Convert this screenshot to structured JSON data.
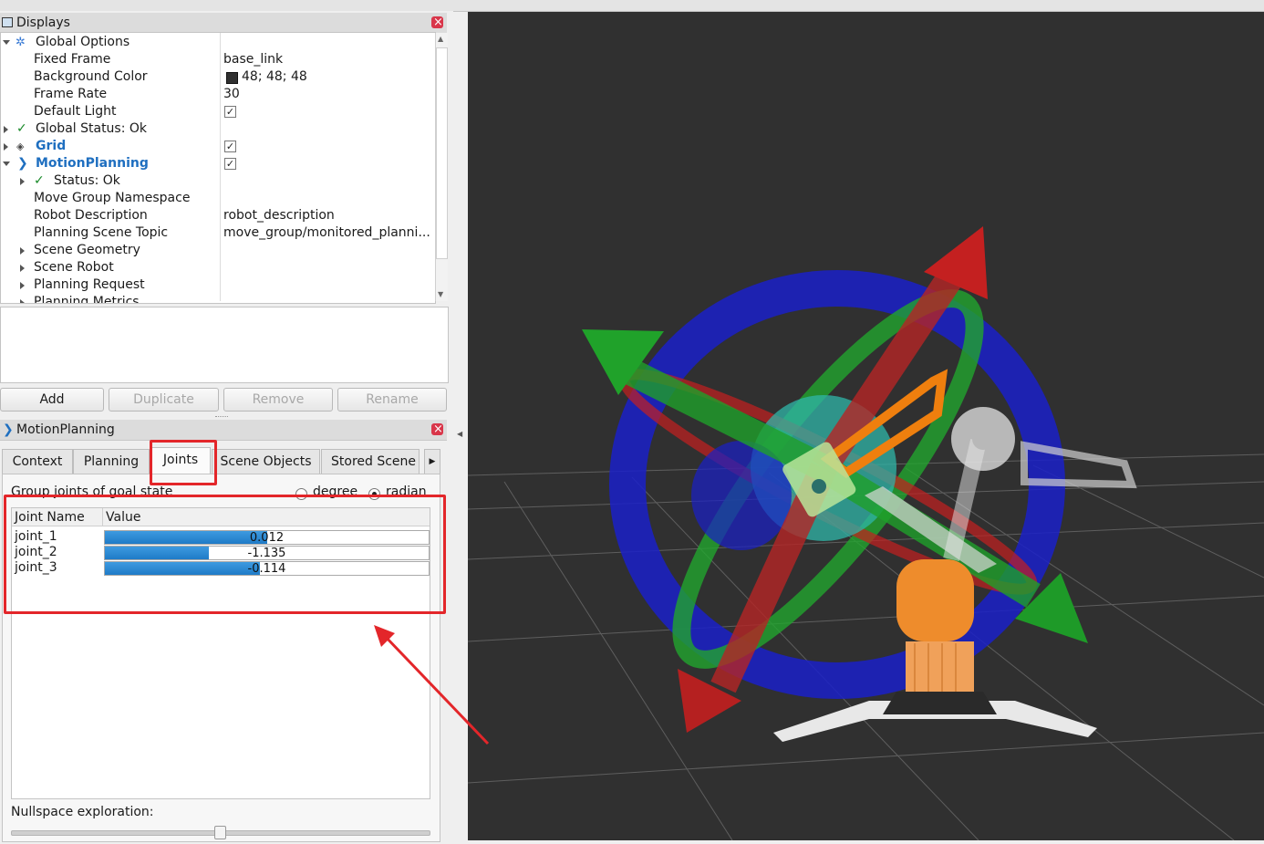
{
  "displays_panel": {
    "title": "Displays",
    "tree": [
      {
        "label": "Global Options",
        "value": ""
      },
      {
        "label": "Fixed Frame",
        "value": "base_link"
      },
      {
        "label": "Background Color",
        "value": "48; 48; 48",
        "color": "#303030"
      },
      {
        "label": "Frame Rate",
        "value": "30"
      },
      {
        "label": "Default Light",
        "checked": true
      },
      {
        "label": "Global Status: Ok"
      },
      {
        "label": "Grid",
        "checked": true
      },
      {
        "label": "MotionPlanning",
        "checked": true
      },
      {
        "label": "Status: Ok"
      },
      {
        "label": "Move Group Namespace",
        "value": ""
      },
      {
        "label": "Robot Description",
        "value": "robot_description"
      },
      {
        "label": "Planning Scene Topic",
        "value": "move_group/monitored_planni..."
      },
      {
        "label": "Scene Geometry"
      },
      {
        "label": "Scene Robot"
      },
      {
        "label": "Planning Request"
      },
      {
        "label": "Planning Metrics"
      }
    ],
    "buttons": {
      "add": "Add",
      "duplicate": "Duplicate",
      "remove": "Remove",
      "rename": "Rename"
    }
  },
  "motion_planning": {
    "title": "MotionPlanning",
    "tabs": [
      "Context",
      "Planning",
      "Joints",
      "Scene Objects",
      "Stored Scene"
    ],
    "active_tab": "Joints",
    "group_label": "Group joints of goal state",
    "units": {
      "degree": "degree",
      "radian": "radian",
      "selected": "radian"
    },
    "table_headers": {
      "name": "Joint Name",
      "value": "Value"
    },
    "joints": [
      {
        "name": "joint_1",
        "value": "0.012",
        "fill": 0.5
      },
      {
        "name": "joint_2",
        "value": "-1.135",
        "fill": 0.32
      },
      {
        "name": "joint_3",
        "value": "-0.114",
        "fill": 0.48
      }
    ],
    "nullspace_label": "Nullspace exploration:",
    "nullspace_level": 0.5
  },
  "colors": {
    "highlight": "#e3262a",
    "viewport_bg": "#303030",
    "bar_fill": "#2a8ad6",
    "link_blue": "#1f6fc0"
  }
}
